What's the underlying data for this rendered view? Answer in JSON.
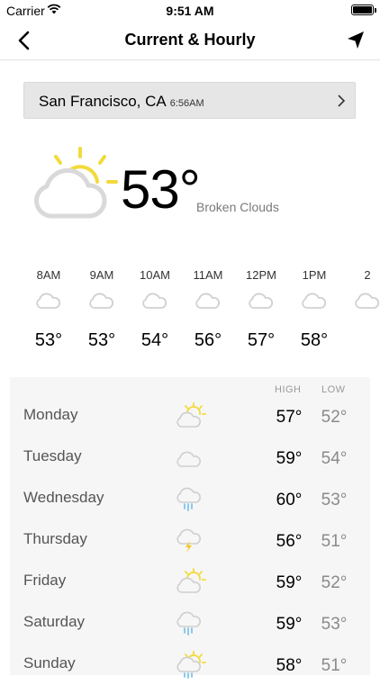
{
  "status_bar": {
    "carrier": "Carrier",
    "time": "9:51 AM"
  },
  "nav": {
    "title": "Current & Hourly",
    "back_icon": "chevron-left-icon",
    "location_icon": "location-arrow-icon"
  },
  "location": {
    "city": "San Francisco, CA",
    "time": "6:56AM"
  },
  "current": {
    "temp": "53°",
    "condition": "Broken Clouds",
    "icon": "partly-cloudy-icon"
  },
  "hourly": [
    {
      "time": "8AM",
      "temp": "53°",
      "icon": "cloud-icon"
    },
    {
      "time": "9AM",
      "temp": "53°",
      "icon": "cloud-icon"
    },
    {
      "time": "10AM",
      "temp": "54°",
      "icon": "cloud-icon"
    },
    {
      "time": "11AM",
      "temp": "56°",
      "icon": "cloud-icon"
    },
    {
      "time": "12PM",
      "temp": "57°",
      "icon": "cloud-icon"
    },
    {
      "time": "1PM",
      "temp": "58°",
      "icon": "cloud-icon"
    },
    {
      "time": "2",
      "temp": "",
      "icon": "cloud-icon"
    }
  ],
  "daily": {
    "high_label": "HIGH",
    "low_label": "LOW",
    "days": [
      {
        "day": "Monday",
        "high": "57°",
        "low": "52°",
        "icon": "partly-cloudy-icon"
      },
      {
        "day": "Tuesday",
        "high": "59°",
        "low": "54°",
        "icon": "cloud-icon"
      },
      {
        "day": "Wednesday",
        "high": "60°",
        "low": "53°",
        "icon": "rain-icon"
      },
      {
        "day": "Thursday",
        "high": "56°",
        "low": "51°",
        "icon": "thunderstorm-icon"
      },
      {
        "day": "Friday",
        "high": "59°",
        "low": "52°",
        "icon": "partly-cloudy-icon"
      },
      {
        "day": "Saturday",
        "high": "59°",
        "low": "53°",
        "icon": "rain-icon"
      },
      {
        "day": "Sunday",
        "high": "58°",
        "low": "51°",
        "icon": "sun-rain-icon"
      }
    ]
  },
  "colors": {
    "sun": "#f2da3c",
    "cloud": "#d9d9d9",
    "rain": "#7fc4ea",
    "bolt": "#f2c61f"
  }
}
